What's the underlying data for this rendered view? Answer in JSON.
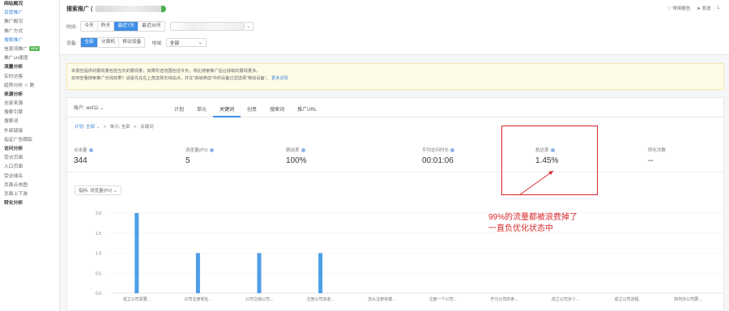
{
  "sidebar": {
    "items": [
      {
        "label": "网站概况",
        "type": "group"
      },
      {
        "label": "百度推广",
        "type": "active"
      },
      {
        "label": "推广概况",
        "type": "item"
      },
      {
        "label": "推广方式",
        "type": "item"
      },
      {
        "label": "搜索推广",
        "type": "active"
      },
      {
        "label": "信息流推广",
        "type": "item",
        "badge": "NEW"
      },
      {
        "label": "推广url速度",
        "type": "item"
      },
      {
        "label": "流量分析",
        "type": "group"
      },
      {
        "label": "实时访客",
        "type": "item"
      },
      {
        "label": "趋势分析 ☆ 数",
        "type": "item"
      },
      {
        "label": "来源分析",
        "type": "group"
      },
      {
        "label": "全部来源",
        "type": "item"
      },
      {
        "label": "搜索引擎",
        "type": "item"
      },
      {
        "label": "搜索词",
        "type": "item"
      },
      {
        "label": "外部链接",
        "type": "item"
      },
      {
        "label": "指定广告跟踪",
        "type": "item"
      },
      {
        "label": "访问分析",
        "type": "group"
      },
      {
        "label": "受访页面",
        "type": "item"
      },
      {
        "label": "入口页面",
        "type": "item"
      },
      {
        "label": "受访域名",
        "type": "item"
      },
      {
        "label": "页面点击图",
        "type": "item"
      },
      {
        "label": "页面上下游",
        "type": "item"
      },
      {
        "label": "转化分析",
        "type": "group"
      }
    ]
  },
  "header": {
    "title": "搜索推广",
    "title_suffix": "(",
    "links": [
      "常用报告",
      "发送"
    ],
    "time_label": "时间:",
    "time_options": [
      "今天",
      "昨天",
      "最近7天",
      "最近30天"
    ],
    "time_selected": 2,
    "device_label": "设备:",
    "device_options": [
      "全部",
      "计算机",
      "移动设备"
    ],
    "device_selected": 0,
    "region_label": "地域:",
    "region_value": "全部"
  },
  "notice": {
    "line1": "本报告提供的展现量包括当天的展现量，如果所选范围包括今天，将比搜索推广后台获取的展现量多。",
    "line2": "如何查看搜索推广无线效果？请首先在右上角选择无线站点，并在“高级筛选”中的设备过滤选择“移动设备”。",
    "link": "更多详情"
  },
  "report": {
    "account": "账户: wsf11 ⌄",
    "tabs": [
      "计划",
      "单元",
      "关键词",
      "创意",
      "搜索词",
      "推广URL"
    ],
    "active_tab": 2,
    "breadcrumb": {
      "plan": "计划: 全部 ⌄",
      "sep1": ">",
      "unit": "单元: 全部",
      "sep2": ">",
      "current": "关键词"
    },
    "metrics": [
      {
        "label": "点击量",
        "value": "344"
      },
      {
        "label": "浏览量(PV)",
        "value": "5"
      },
      {
        "label": "跳出率",
        "value": "100%"
      },
      {
        "label": "平均访问时长",
        "value": "00:01:06"
      },
      {
        "label": "抵达率",
        "value": "1.45%"
      },
      {
        "label": "转化次数",
        "value": "--"
      }
    ],
    "chart_selector": "指标: 浏览量(PV) ⌄"
  },
  "chart_data": {
    "type": "bar",
    "categories": [
      "成立公司需要...",
      "公司注册地址...",
      "公司注销公司...",
      "注册公司资金...",
      "怎么注册快捷...",
      "注册一个公司...",
      "开分公司的条...",
      "成立公司多少...",
      "成立公司流程",
      "如何办公司要..."
    ],
    "values": [
      2,
      1,
      1,
      1,
      0,
      0,
      0,
      0,
      0,
      0
    ],
    "ylim": [
      0,
      2
    ],
    "yticks": [
      "0.0",
      "0.5",
      "1.0",
      "1.5",
      "2.0"
    ],
    "bar_color": "#4d9ee8"
  },
  "annotation": {
    "line1": "99%的流量都被浪费掉了",
    "line2": "一直负优化状态中",
    "color": "#d9282b"
  }
}
